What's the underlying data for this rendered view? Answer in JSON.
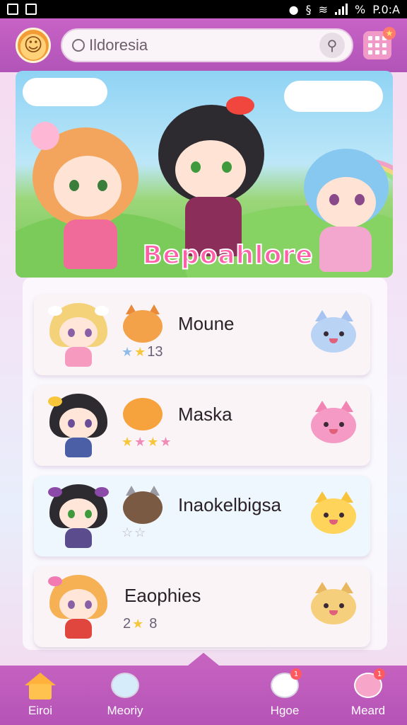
{
  "status_bar": {
    "time": "P.0:A",
    "battery_text": "%"
  },
  "search": {
    "placeholder": "Ildoresia"
  },
  "banner": {
    "title": "Bepoahlore"
  },
  "list": [
    {
      "name": "Moune",
      "stats": "13"
    },
    {
      "name": "Maska",
      "stats": ""
    },
    {
      "name": "Inaokelbigsa",
      "stats": ""
    },
    {
      "name": "Eaophies",
      "stats_left": "2",
      "stats_right": "8"
    }
  ],
  "nav": [
    {
      "label": "Eiroi",
      "icon": "home-icon"
    },
    {
      "label": "Meoriy",
      "icon": "cat-icon"
    },
    {
      "label": "Hgoe",
      "icon": "chat-icon",
      "badge": "1"
    },
    {
      "label": "Meard",
      "icon": "pig-icon",
      "badge": "1"
    }
  ],
  "colors": {
    "app_bar": "#c862c6",
    "accent_pink": "#f29ac7",
    "nav_bar": "#b553b7"
  }
}
